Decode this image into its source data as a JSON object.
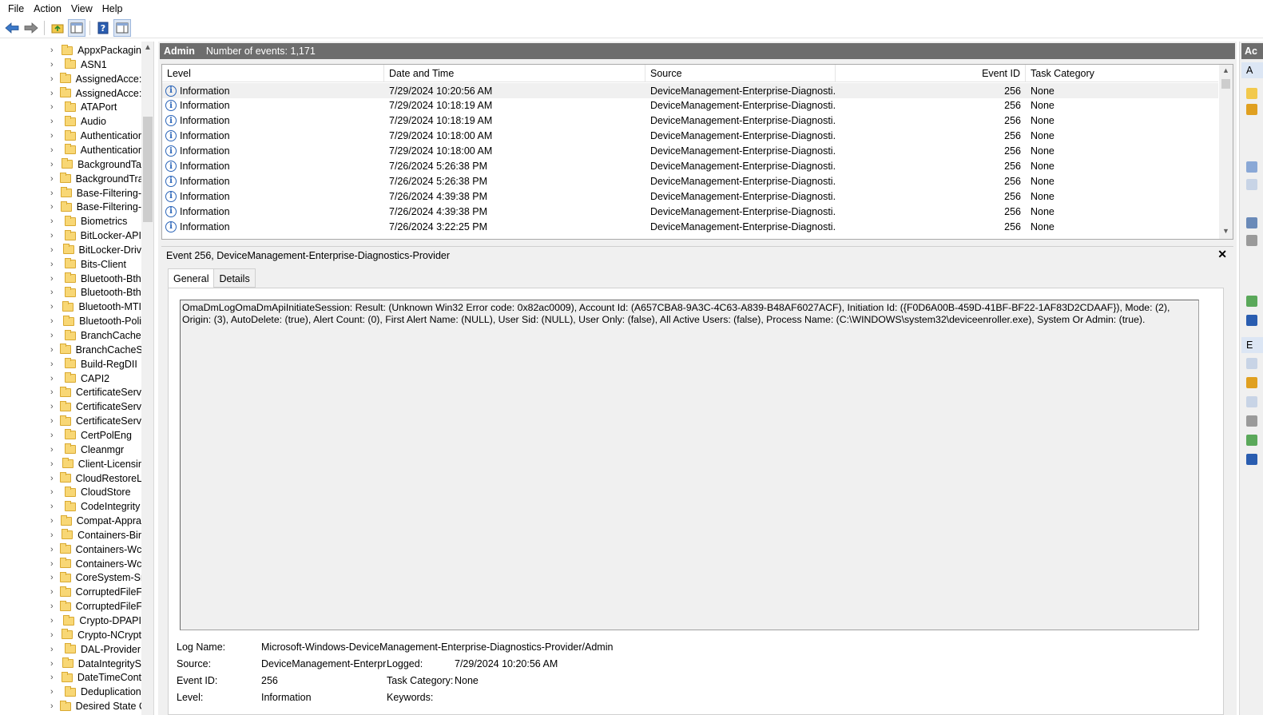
{
  "menu": [
    "File",
    "Action",
    "View",
    "Help"
  ],
  "toolbar": {
    "icons": [
      "back-arrow-icon",
      "forward-arrow-icon",
      "folder-up-icon",
      "show-hide-tree-icon",
      "help-icon",
      "show-action-pane-icon"
    ]
  },
  "tree": {
    "items": [
      "AppxPackagin",
      "ASN1",
      "AssignedAcce:",
      "AssignedAcce:",
      "ATAPort",
      "Audio",
      "Authenticatior",
      "Authenticatior",
      "BackgroundTa",
      "BackgroundTra",
      "Base-Filtering-",
      "Base-Filtering-",
      "Biometrics",
      "BitLocker-API",
      "BitLocker-Driv",
      "Bits-Client",
      "Bluetooth-Bth",
      "Bluetooth-Bth",
      "Bluetooth-MTI",
      "Bluetooth-Poli",
      "BranchCache",
      "BranchCacheS",
      "Build-RegDII",
      "CAPI2",
      "CertificateServ",
      "CertificateServ",
      "CertificateServ",
      "CertPolEng",
      "Cleanmgr",
      "Client-Licensir",
      "CloudRestoreL",
      "CloudStore",
      "CodeIntegrity",
      "Compat-Appra",
      "Containers-Bir",
      "Containers-Wc",
      "Containers-Wc",
      "CoreSystem-Sr",
      "CorruptedFileF",
      "CorruptedFileF",
      "Crypto-DPAPI",
      "Crypto-NCrypt",
      "DAL-Provider",
      "DataIntegrityS",
      "DateTimeCont",
      "Deduplication",
      "Desired State C"
    ]
  },
  "log": {
    "title": "Admin",
    "count_text": "Number of events: 1,171"
  },
  "grid": {
    "columns": [
      "Level",
      "Date and Time",
      "Source",
      "Event ID",
      "Task Category"
    ],
    "rows": [
      {
        "level": "Information",
        "datetime": "7/29/2024 10:20:56 AM",
        "source": "DeviceManagement-Enterprise-Diagnosti...",
        "event_id": "256",
        "category": "None"
      },
      {
        "level": "Information",
        "datetime": "7/29/2024 10:18:19 AM",
        "source": "DeviceManagement-Enterprise-Diagnosti...",
        "event_id": "256",
        "category": "None"
      },
      {
        "level": "Information",
        "datetime": "7/29/2024 10:18:19 AM",
        "source": "DeviceManagement-Enterprise-Diagnosti...",
        "event_id": "256",
        "category": "None"
      },
      {
        "level": "Information",
        "datetime": "7/29/2024 10:18:00 AM",
        "source": "DeviceManagement-Enterprise-Diagnosti...",
        "event_id": "256",
        "category": "None"
      },
      {
        "level": "Information",
        "datetime": "7/29/2024 10:18:00 AM",
        "source": "DeviceManagement-Enterprise-Diagnosti...",
        "event_id": "256",
        "category": "None"
      },
      {
        "level": "Information",
        "datetime": "7/26/2024 5:26:38 PM",
        "source": "DeviceManagement-Enterprise-Diagnosti...",
        "event_id": "256",
        "category": "None"
      },
      {
        "level": "Information",
        "datetime": "7/26/2024 5:26:38 PM",
        "source": "DeviceManagement-Enterprise-Diagnosti...",
        "event_id": "256",
        "category": "None"
      },
      {
        "level": "Information",
        "datetime": "7/26/2024 4:39:38 PM",
        "source": "DeviceManagement-Enterprise-Diagnosti...",
        "event_id": "256",
        "category": "None"
      },
      {
        "level": "Information",
        "datetime": "7/26/2024 4:39:38 PM",
        "source": "DeviceManagement-Enterprise-Diagnosti...",
        "event_id": "256",
        "category": "None"
      },
      {
        "level": "Information",
        "datetime": "7/26/2024 3:22:25 PM",
        "source": "DeviceManagement-Enterprise-Diagnosti...",
        "event_id": "256",
        "category": "None"
      }
    ]
  },
  "detail": {
    "title": "Event 256, DeviceManagement-Enterprise-Diagnostics-Provider",
    "close_symbol": "✕",
    "tabs": [
      "General",
      "Details"
    ],
    "message": "OmaDmLogOmaDmApiInitiateSession: Result: (Unknown Win32 Error code: 0x82ac0009), Account Id: (A657CBA8-9A3C-4C63-A839-B48AF6027ACF), Initiation Id: ({F0D6A00B-459D-41BF-BF22-1AF83D2CDAAF}), Mode: (2), Origin: (3), AutoDelete: (true), Alert Count: (0), First Alert Name: (NULL), User Sid: (NULL), User Only: (false), All Active Users: (false), Process Name: (C:\\WINDOWS\\system32\\deviceenroller.exe), System Or Admin: (true).",
    "props": {
      "log_name_label": "Log Name:",
      "log_name": "Microsoft-Windows-DeviceManagement-Enterprise-Diagnostics-Provider/Admin",
      "source_label": "Source:",
      "source": "DeviceManagement-Enterpr",
      "logged_label": "Logged:",
      "logged": "7/29/2024 10:20:56 AM",
      "event_id_label": "Event ID:",
      "event_id": "256",
      "task_category_label": "Task Category:",
      "task_category": "None",
      "level_label": "Level:",
      "level": "Information",
      "keywords_label": "Keywords:"
    }
  },
  "actions": {
    "header": "Ac",
    "sub1": "A",
    "sub2": "E"
  }
}
